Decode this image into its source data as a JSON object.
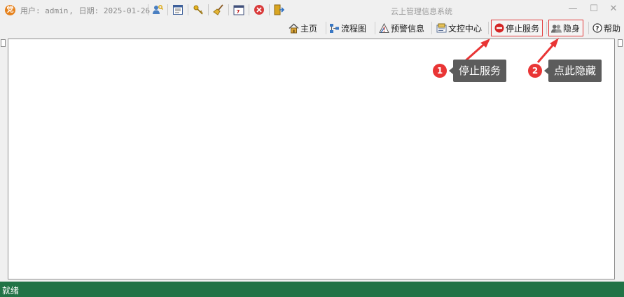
{
  "window": {
    "app_icon_glyph": "党",
    "title": "云上管理信息系统",
    "minimize_glyph": "—",
    "maximize_glyph": "☐",
    "close_glyph": "✕"
  },
  "user_info": {
    "user_label": "用户:",
    "username": "admin",
    "separator": ",",
    "date_label": "日期:",
    "date": "2025-01-26"
  },
  "quick_toolbar": [
    "user-search-icon",
    "form-icon",
    "key-icon",
    "broom-icon",
    "calendar-icon",
    "close-circle-icon",
    "exit-door-icon"
  ],
  "toolbar": {
    "home": "主页",
    "flowchart": "流程图",
    "warning_info": "预警信息",
    "document_center": "文控中心",
    "stop_service": "停止服务",
    "stealth": "隐身",
    "help": "帮助"
  },
  "annotations": [
    {
      "number": "1",
      "text": "停止服务"
    },
    {
      "number": "2",
      "text": "点此隐藏"
    }
  ],
  "colors": {
    "status_bar": "#217346",
    "highlight_border": "#e23b3b",
    "badge": "#e93535",
    "callout": "#5c5c5c"
  },
  "status": {
    "text": "就绪"
  }
}
